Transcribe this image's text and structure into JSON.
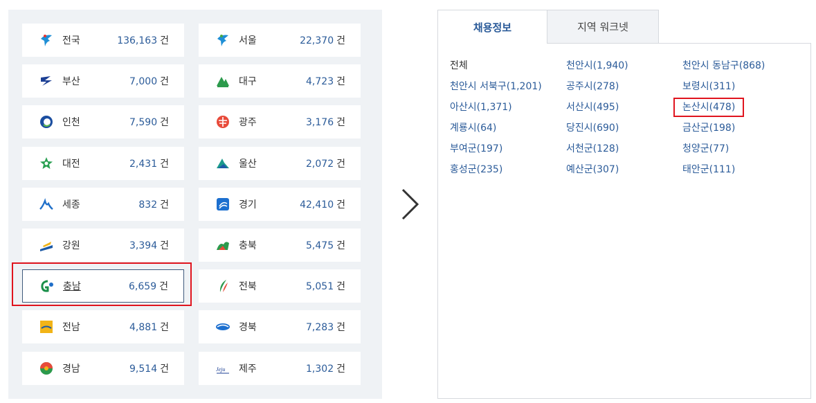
{
  "regions": [
    {
      "name": "전국",
      "count": "136,163",
      "icon": "star-emblem-icon"
    },
    {
      "name": "서울",
      "count": "22,370",
      "icon": "seoul-emblem-icon"
    },
    {
      "name": "부산",
      "count": "7,000",
      "icon": "busan-emblem-icon"
    },
    {
      "name": "대구",
      "count": "4,723",
      "icon": "daegu-emblem-icon"
    },
    {
      "name": "인천",
      "count": "7,590",
      "icon": "incheon-emblem-icon"
    },
    {
      "name": "광주",
      "count": "3,176",
      "icon": "gwangju-emblem-icon"
    },
    {
      "name": "대전",
      "count": "2,431",
      "icon": "daejeon-emblem-icon"
    },
    {
      "name": "울산",
      "count": "2,072",
      "icon": "ulsan-emblem-icon"
    },
    {
      "name": "세종",
      "count": "832",
      "icon": "sejong-emblem-icon"
    },
    {
      "name": "경기",
      "count": "42,410",
      "icon": "gyeonggi-emblem-icon"
    },
    {
      "name": "강원",
      "count": "3,394",
      "icon": "gangwon-emblem-icon"
    },
    {
      "name": "충북",
      "count": "5,475",
      "icon": "chungbuk-emblem-icon"
    },
    {
      "name": "충남",
      "count": "6,659",
      "icon": "chungnam-emblem-icon"
    },
    {
      "name": "전북",
      "count": "5,051",
      "icon": "jeonbuk-emblem-icon"
    },
    {
      "name": "전남",
      "count": "4,881",
      "icon": "jeonnam-emblem-icon"
    },
    {
      "name": "경북",
      "count": "7,283",
      "icon": "gyeongbuk-emblem-icon"
    },
    {
      "name": "경남",
      "count": "9,514",
      "icon": "gyeongnam-emblem-icon"
    },
    {
      "name": "제주",
      "count": "1,302",
      "icon": "jeju-emblem-icon"
    }
  ],
  "count_unit": "건",
  "selected_region": "충남",
  "tabs": [
    {
      "label": "채용정보",
      "active": true
    },
    {
      "label": "지역 워크넷",
      "active": false
    }
  ],
  "cities": [
    "전체",
    "천안시(1,940)",
    "천안시 동남구(868)",
    "천안시 서북구(1,201)",
    "공주시(278)",
    "보령시(311)",
    "아산시(1,371)",
    "서산시(495)",
    "논산시(478)",
    "계룡시(64)",
    "당진시(690)",
    "금산군(198)",
    "부여군(197)",
    "서천군(128)",
    "청양군(77)",
    "홍성군(235)",
    "예산군(307)",
    "태안군(111)"
  ],
  "highlighted_city": "논산시(478)",
  "colors": {
    "accent": "#2b5b99",
    "highlight": "#e0141e",
    "panel_bg": "#eff2f5"
  }
}
